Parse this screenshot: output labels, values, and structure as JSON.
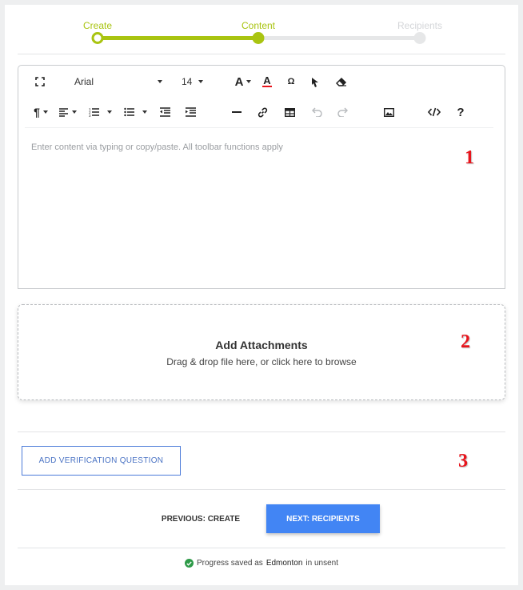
{
  "stepper": {
    "steps": [
      {
        "label": "Create",
        "state": "done"
      },
      {
        "label": "Content",
        "state": "current"
      },
      {
        "label": "Recipients",
        "state": "todo"
      }
    ],
    "colors": {
      "active": "#a9c411",
      "inactive": "#e6e7e8"
    }
  },
  "toolbar": {
    "font_family": "Arial",
    "font_size": "14",
    "row1_icons": [
      "fullscreen-icon",
      "font-family-select",
      "font-size-select",
      "text-size-icon",
      "font-color-icon",
      "special-char-icon",
      "select-pointer-icon",
      "eraser-icon"
    ],
    "row2_icons": [
      "paragraph-icon",
      "align-icon",
      "ordered-list-icon",
      "unordered-list-icon",
      "outdent-icon",
      "indent-icon",
      "horizontal-rule-icon",
      "link-icon",
      "table-icon",
      "undo-icon",
      "redo-icon",
      "image-icon",
      "code-view-icon",
      "help-icon"
    ],
    "special_char_glyph": "Ω",
    "help_glyph": "?"
  },
  "editor": {
    "placeholder": "Enter content via typing or copy/paste. All toolbar functions apply"
  },
  "annotations": [
    "1",
    "2",
    "3"
  ],
  "attachments": {
    "title": "Add Attachments",
    "subtitle": "Drag & drop file here, or click here to browse"
  },
  "verification": {
    "button_label": "ADD VERIFICATION QUESTION"
  },
  "navigation": {
    "previous_label": "PREVIOUS: CREATE",
    "next_label": "NEXT: RECIPIENTS"
  },
  "status": {
    "prefix": "Progress saved as",
    "location": "Edmonton",
    "suffix": "in unsent"
  },
  "colors": {
    "primary": "#4285f4",
    "outline": "#4c7bd9",
    "annotation": "#e8141c",
    "success": "#2e9a48"
  }
}
